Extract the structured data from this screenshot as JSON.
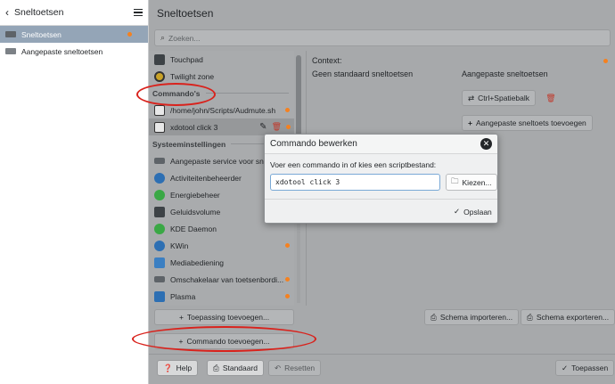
{
  "left": {
    "title": "Sneltoetsen",
    "items": [
      {
        "label": "Sneltoetsen",
        "selected": true,
        "modified": true
      },
      {
        "label": "Aangepaste sneltoetsen",
        "selected": false,
        "modified": false
      }
    ]
  },
  "right": {
    "title": "Sneltoetsen",
    "search_placeholder": "Zoeken...",
    "list": {
      "rows_top": [
        {
          "label": "Touchpad",
          "icon": "touchpad-icon"
        },
        {
          "label": "Twilight zone",
          "icon": "twilight-icon"
        }
      ],
      "section_commands": "Commando's",
      "commands": [
        {
          "label": "/home/john/Scripts/Audmute.sh",
          "modified": true
        },
        {
          "label": "xdotool click 3",
          "modified": true
        }
      ],
      "section_system": "Systeeminstellingen",
      "system": [
        {
          "label": "Aangepaste service voor sne",
          "modified": false
        },
        {
          "label": "Activiteitenbeheerder",
          "modified": false
        },
        {
          "label": "Energiebeheer",
          "modified": false
        },
        {
          "label": "Geluidsvolume",
          "modified": false
        },
        {
          "label": "KDE Daemon",
          "modified": false
        },
        {
          "label": "KWin",
          "modified": true
        },
        {
          "label": "Mediabediening",
          "modified": false
        },
        {
          "label": "Omschakelaar van toetsenbordi...",
          "modified": true
        },
        {
          "label": "Plasma",
          "modified": true
        }
      ]
    },
    "detail": {
      "context": "Context:",
      "col_default": "Geen standaard sneltoetsen",
      "col_custom": "Aangepaste sneltoetsen",
      "shortcut": "Ctrl+Spatiebalk",
      "add_custom": "Aangepaste sneltoets toevoegen"
    },
    "buttons": {
      "add_app": "Toepassing toevoegen...",
      "add_command": "Commando toevoegen...",
      "import": "Schema importeren...",
      "export": "Schema exporteren...",
      "help": "Help",
      "defaults": "Standaard",
      "reset": "Resetten",
      "apply": "Toepassen"
    }
  },
  "dialog": {
    "title": "Commando bewerken",
    "prompt": "Voer een commando in of kies een scriptbestand:",
    "value": "xdotool click 3",
    "choose": "Kiezen...",
    "save": "Opslaan"
  },
  "colors": {
    "accent_orange": "#f5811f",
    "selection": "#94a5b7",
    "annotation_red": "#d9221c"
  }
}
